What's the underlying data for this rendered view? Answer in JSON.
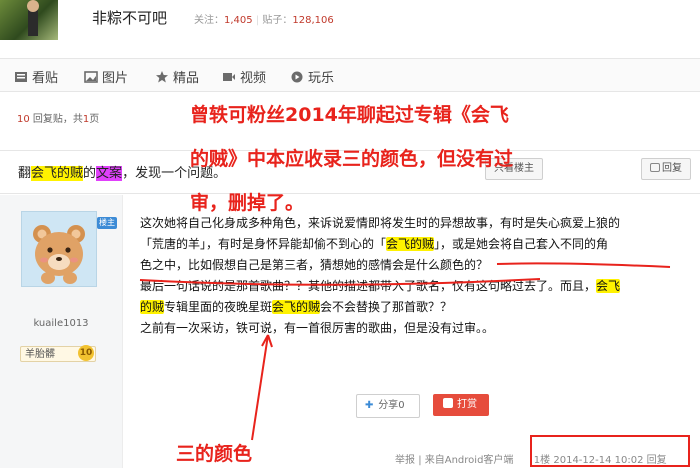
{
  "header": {
    "forum_name": "非粽不可吧",
    "followers_label": "关注：",
    "followers_count": "1,405",
    "posts_label": "贴子：",
    "posts_count": "128,106"
  },
  "nav": {
    "items": [
      {
        "label": "看贴",
        "icon": "document-icon"
      },
      {
        "label": "图片",
        "icon": "image-icon"
      },
      {
        "label": "精品",
        "icon": "star-icon"
      },
      {
        "label": "视频",
        "icon": "video-icon"
      },
      {
        "label": "玩乐",
        "icon": "play-icon"
      }
    ]
  },
  "reply_info": {
    "count": "10",
    "count_suffix": "回复贴，共",
    "pages": "1",
    "pages_suffix": "页"
  },
  "thread": {
    "title_prefix": "翻",
    "title_hl1": "会飞的贼",
    "title_mid": "的",
    "title_hl2": "文案",
    "title_suffix": "，发现一个问题。",
    "only_author_label": "只看楼主",
    "reply_label": "回复"
  },
  "author": {
    "badge": "楼主",
    "name": "kuaile1013",
    "rank_label": "羊胎髒",
    "rank_level": "10"
  },
  "post": {
    "l1": "这次她将自己化身成多种角色，来诉说爱情即将发生时的异想故事，有时是失心疯爱上狼的",
    "l2a": "「荒唐的羊」，有时是身怀异能却偷不到心的「",
    "l2b": "会飞的贼",
    "l2c": "」，或是她会将自己套入不同的角",
    "l3": "色之中，比如假想自己是第三者，猜想她的感情会是什么颜色的？",
    "l4a": "最后一句话说的是那首歌曲？？其他的描述都带入了歌名，仅有这句略过去了。而且，",
    "l4b": "会飞",
    "l5a": "的贼",
    "l5b": "专辑里面的夜晚星斑",
    "l5c": "会飞的贼",
    "l5d": "会不会替换了那首歌？？",
    "l6": "之前有一次采访，铁可说，有一首很厉害的歌曲，但是没有过审。。"
  },
  "actions": {
    "share_label": "分享",
    "share_count": "0",
    "reward_label": "打赏"
  },
  "footer": {
    "report": "举报",
    "separator": "|",
    "source": "来自Android客户端",
    "floor": "1楼",
    "datetime": "2014-12-14 10:02",
    "reply": "回复"
  },
  "annotations": {
    "line1": "曾轶可粉丝2014年聊起过专辑《会飞",
    "line2": "的贼》中本应收录三的颜色，但没有过",
    "line3": "审，删掉了。",
    "bottom": "三的颜色"
  },
  "colors": {
    "annotation_red": "#e8231c",
    "highlight_yellow": "#fff200",
    "highlight_purple": "#e040fb",
    "reward_red": "#e64c3c"
  }
}
